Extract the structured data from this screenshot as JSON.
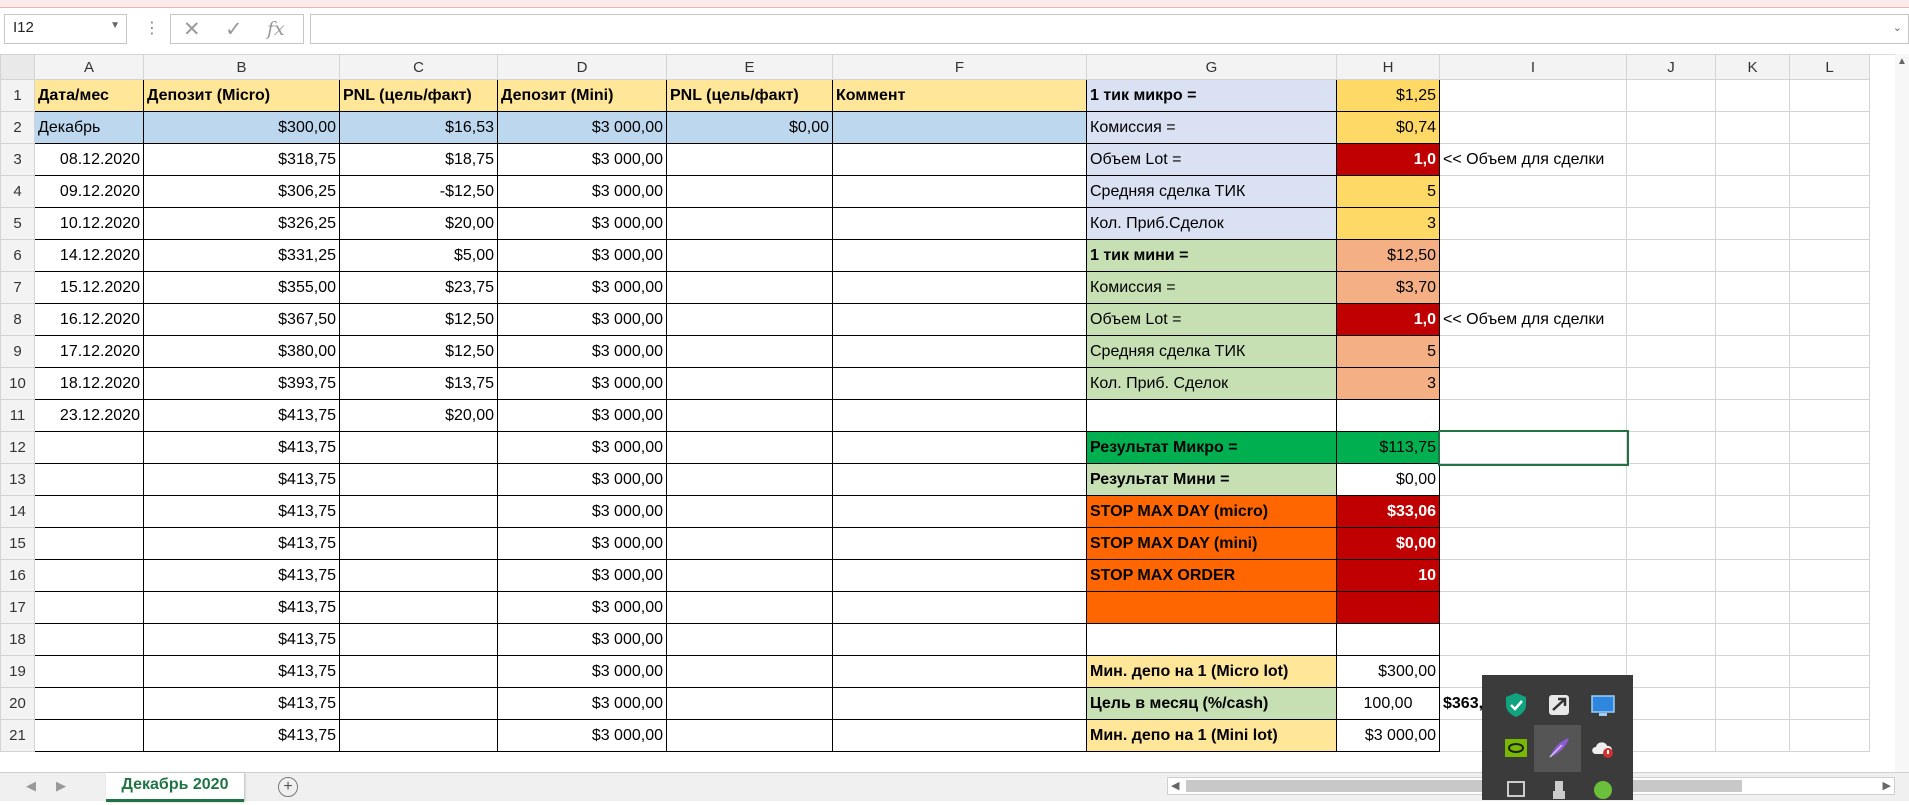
{
  "name_box": {
    "value": "I12"
  },
  "formula_bar": {
    "fx_label": "fx",
    "value": ""
  },
  "columns": [
    "A",
    "B",
    "C",
    "D",
    "E",
    "F",
    "G",
    "H",
    "I",
    "J",
    "K",
    "L"
  ],
  "rows": [
    {
      "n": "1",
      "A": "Дата/мес",
      "B": "Депозит (Micro)",
      "C": "PNL (цель/факт)",
      "D": "Депозит (Mini)",
      "E": "PNL (цель/факт)",
      "F": "Коммент",
      "G": "1 тик микро =",
      "H": "$1,25",
      "I": ""
    },
    {
      "n": "2",
      "A": "Декабрь",
      "B": "$300,00",
      "C": "$16,53",
      "D": "$3 000,00",
      "E": "$0,00",
      "F": "",
      "G": "Комиссия =",
      "H": "$0,74",
      "I": ""
    },
    {
      "n": "3",
      "A": "08.12.2020",
      "B": "$318,75",
      "C": "$18,75",
      "D": "$3 000,00",
      "E": "",
      "F": "",
      "G": "Объем  Lot =",
      "H": "1,0",
      "I": "<< Объем для сделки"
    },
    {
      "n": "4",
      "A": "09.12.2020",
      "B": "$306,25",
      "C": "-$12,50",
      "D": "$3 000,00",
      "E": "",
      "F": "",
      "G": "Средняя сделка ТИК",
      "H": "5",
      "I": ""
    },
    {
      "n": "5",
      "A": "10.12.2020",
      "B": "$326,25",
      "C": "$20,00",
      "D": "$3 000,00",
      "E": "",
      "F": "",
      "G": "Кол. Приб.Сделок",
      "H": "3",
      "I": ""
    },
    {
      "n": "6",
      "A": "14.12.2020",
      "B": "$331,25",
      "C": "$5,00",
      "D": "$3 000,00",
      "E": "",
      "F": "",
      "G": "1 тик мини =",
      "H": "$12,50",
      "I": ""
    },
    {
      "n": "7",
      "A": "15.12.2020",
      "B": "$355,00",
      "C": "$23,75",
      "D": "$3 000,00",
      "E": "",
      "F": "",
      "G": "Комиссия =",
      "H": "$3,70",
      "I": ""
    },
    {
      "n": "8",
      "A": "16.12.2020",
      "B": "$367,50",
      "C": "$12,50",
      "D": "$3 000,00",
      "E": "",
      "F": "",
      "G": "Объем  Lot =",
      "H": "1,0",
      "I": "<< Объем для сделки"
    },
    {
      "n": "9",
      "A": "17.12.2020",
      "B": "$380,00",
      "C": "$12,50",
      "D": "$3 000,00",
      "E": "",
      "F": "",
      "G": "Средняя сделка ТИК",
      "H": "5",
      "I": ""
    },
    {
      "n": "10",
      "A": "18.12.2020",
      "B": "$393,75",
      "C": "$13,75",
      "D": "$3 000,00",
      "E": "",
      "F": "",
      "G": "Кол. Приб. Сделок",
      "H": "3",
      "I": ""
    },
    {
      "n": "11",
      "A": "23.12.2020",
      "B": "$413,75",
      "C": "$20,00",
      "D": "$3 000,00",
      "E": "",
      "F": "",
      "G": "",
      "H": "",
      "I": ""
    },
    {
      "n": "12",
      "A": "",
      "B": "$413,75",
      "C": "",
      "D": "$3 000,00",
      "E": "",
      "F": "",
      "G": "Результат Микро =",
      "H": "$113,75",
      "I": ""
    },
    {
      "n": "13",
      "A": "",
      "B": "$413,75",
      "C": "",
      "D": "$3 000,00",
      "E": "",
      "F": "",
      "G": "Результат Мини =",
      "H": "$0,00",
      "I": ""
    },
    {
      "n": "14",
      "A": "",
      "B": "$413,75",
      "C": "",
      "D": "$3 000,00",
      "E": "",
      "F": "",
      "G": "STOP MAX DAY (micro)",
      "H": "$33,06",
      "I": ""
    },
    {
      "n": "15",
      "A": "",
      "B": "$413,75",
      "C": "",
      "D": "$3 000,00",
      "E": "",
      "F": "",
      "G": "STOP MAX DAY (mini)",
      "H": "$0,00",
      "I": ""
    },
    {
      "n": "16",
      "A": "",
      "B": "$413,75",
      "C": "",
      "D": "$3 000,00",
      "E": "",
      "F": "",
      "G": "STOP MAX ORDER",
      "H": "10",
      "I": ""
    },
    {
      "n": "17",
      "A": "",
      "B": "$413,75",
      "C": "",
      "D": "$3 000,00",
      "E": "",
      "F": "",
      "G": "",
      "H": "",
      "I": ""
    },
    {
      "n": "18",
      "A": "",
      "B": "$413,75",
      "C": "",
      "D": "$3 000,00",
      "E": "",
      "F": "",
      "G": "",
      "H": "",
      "I": ""
    },
    {
      "n": "19",
      "A": "",
      "B": "$413,75",
      "C": "",
      "D": "$3 000,00",
      "E": "",
      "F": "",
      "G": "Мин. депо на 1 (Micro lot)",
      "H": "$300,00",
      "I": ""
    },
    {
      "n": "20",
      "A": "",
      "B": "$413,75",
      "C": "",
      "D": "$3 000,00",
      "E": "",
      "F": "",
      "G": "Цель в месяц (%/cash)",
      "H": "100,00",
      "I": "$363,"
    },
    {
      "n": "21",
      "A": "",
      "B": "$413,75",
      "C": "",
      "D": "$3 000,00",
      "E": "",
      "F": "",
      "G": "Мин. депо на 1 (Mini lot)",
      "H": "$3 000,00",
      "I": ""
    }
  ],
  "sheet_tabs": [
    {
      "label": "Декабрь 2020",
      "active": true
    }
  ],
  "colors": {
    "excel_green": "#217346",
    "header_yellow": "#ffe699",
    "row2_blue": "#bdd7ee",
    "micro_block": "#d9e1f2",
    "micro_values": "#ffd966",
    "lot_red": "#c00000",
    "mini_block": "#c6e0b4",
    "mini_values": "#f4b084",
    "result_green": "#00b050",
    "stop_orange": "#ff6600"
  },
  "tray_icons": [
    "shield-icon",
    "app-icon",
    "monitor-icon",
    "nvidia-icon",
    "feather-icon",
    "cloud-alert-icon"
  ]
}
